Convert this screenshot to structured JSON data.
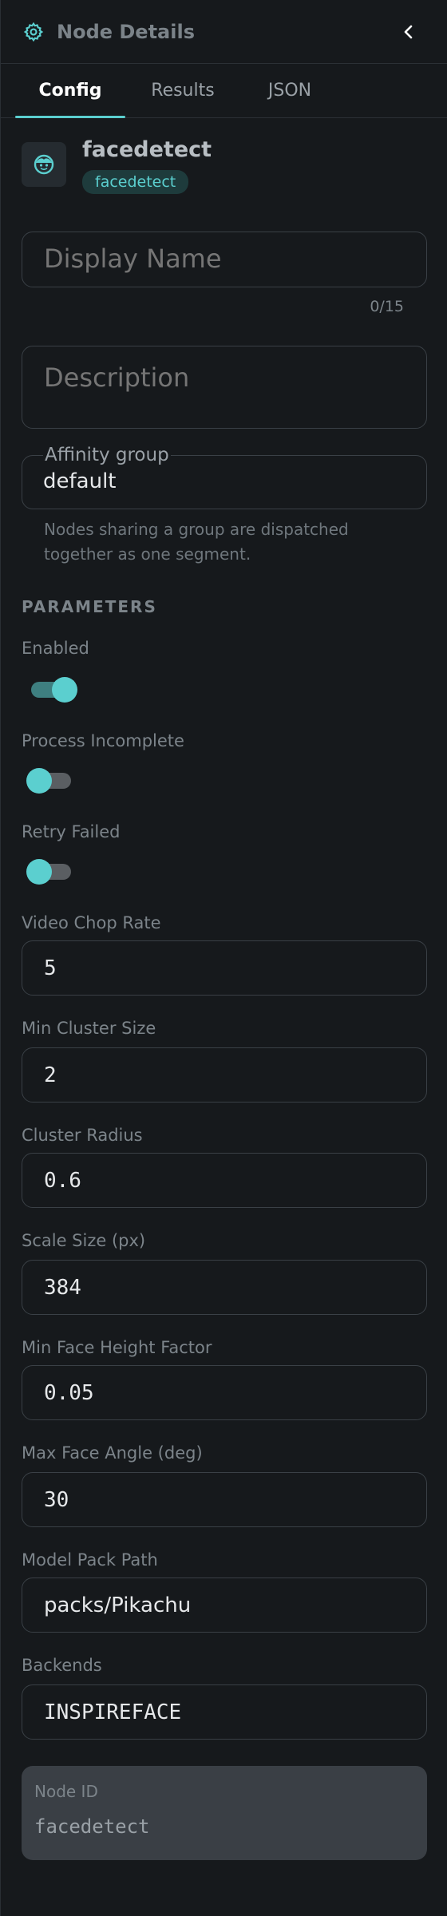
{
  "header": {
    "title": "Node Details",
    "gear_icon": "gear-icon",
    "back_icon": "chevron-left-icon"
  },
  "tabs": [
    {
      "label": "Config",
      "active": true
    },
    {
      "label": "Results",
      "active": false
    },
    {
      "label": "JSON",
      "active": false
    }
  ],
  "node": {
    "name": "facedetect",
    "type_chip": "facedetect",
    "avatar_icon": "face-icon"
  },
  "display_name": {
    "placeholder": "Display Name",
    "value": "",
    "counter": "0/15"
  },
  "description": {
    "placeholder": "Description",
    "value": ""
  },
  "affinity": {
    "label": "Affinity group",
    "value": "default",
    "helper": "Nodes sharing a group are dispatched together as one segment."
  },
  "parameters": {
    "section_label": "PARAMETERS",
    "enabled": {
      "label": "Enabled",
      "on": true
    },
    "process_incomplete": {
      "label": "Process Incomplete",
      "on": false
    },
    "retry_failed": {
      "label": "Retry Failed",
      "on": false
    },
    "video_chop_rate": {
      "label": "Video Chop Rate",
      "value": "5"
    },
    "min_cluster_size": {
      "label": "Min Cluster Size",
      "value": "2"
    },
    "cluster_radius": {
      "label": "Cluster Radius",
      "value": "0.6"
    },
    "scale_size": {
      "label": "Scale Size (px)",
      "value": "384"
    },
    "min_face_height_factor": {
      "label": "Min Face Height Factor",
      "value": "0.05"
    },
    "max_face_angle": {
      "label": "Max Face Angle (deg)",
      "value": "30"
    },
    "model_pack_path": {
      "label": "Model Pack Path",
      "value": "packs/Pikachu"
    },
    "backends": {
      "label": "Backends",
      "value": "INSPIREFACE"
    }
  },
  "node_id": {
    "label": "Node ID",
    "value": "facedetect"
  },
  "colors": {
    "accent": "#5bcfcf",
    "background": "#16191c",
    "border": "#3a4046",
    "muted": "#7c848a"
  }
}
